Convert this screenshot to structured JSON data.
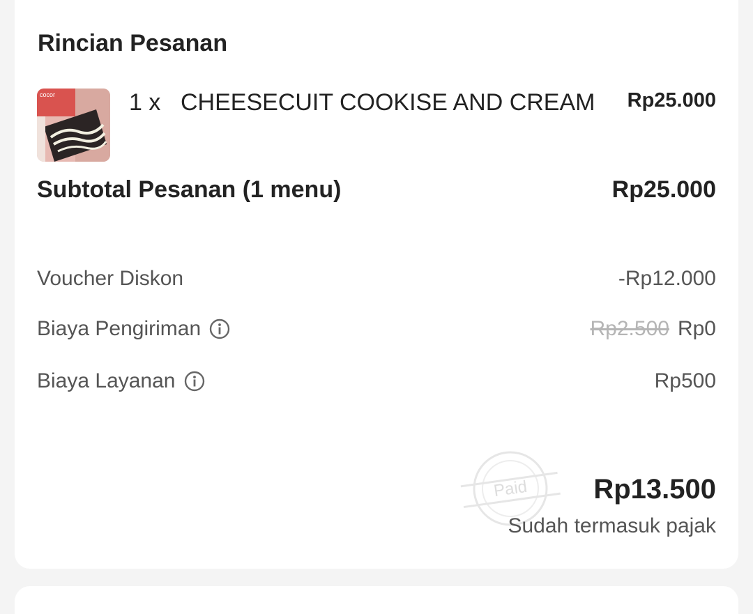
{
  "order_details": {
    "title": "Rincian Pesanan",
    "item": {
      "quantity": "1 x",
      "name": "CHEESECUIT COOKISE AND CREAM",
      "price": "Rp25.000",
      "thumbnail_icon": "cheesecake-product-photo"
    },
    "subtotal": {
      "label": "Subtotal Pesanan (1 menu)",
      "value": "Rp25.000"
    },
    "voucher": {
      "label": "Voucher Diskon",
      "value": "-Rp12.000"
    },
    "shipping": {
      "label": "Biaya Pengiriman",
      "original_value": "Rp2.500",
      "value": "Rp0",
      "info_icon": "info-icon"
    },
    "service": {
      "label": "Biaya Layanan",
      "value": "Rp500",
      "info_icon": "info-icon"
    },
    "total": {
      "value": "Rp13.500",
      "note": "Sudah termasuk pajak"
    },
    "stamp_text": "Paid"
  },
  "colors": {
    "background": "#f4f4f4",
    "card": "#ffffff",
    "text_primary": "#222222",
    "text_secondary": "#555555",
    "strikethrough": "#b5b5b5"
  }
}
